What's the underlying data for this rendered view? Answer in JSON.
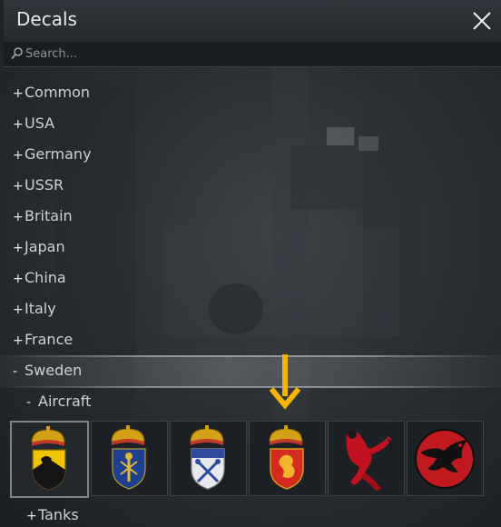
{
  "window": {
    "title": "Decals",
    "close_icon": "close-icon"
  },
  "search": {
    "placeholder": "Search...",
    "value": "",
    "icon": "search-icon"
  },
  "tree": {
    "countries": [
      {
        "sign": "+",
        "label": "Common"
      },
      {
        "sign": "+",
        "label": "USA"
      },
      {
        "sign": "+",
        "label": "Germany"
      },
      {
        "sign": "+",
        "label": "USSR"
      },
      {
        "sign": "+",
        "label": "Britain"
      },
      {
        "sign": "+",
        "label": "Japan"
      },
      {
        "sign": "+",
        "label": "China"
      },
      {
        "sign": "+",
        "label": "Italy"
      },
      {
        "sign": "+",
        "label": "France"
      },
      {
        "sign": "-",
        "label": "Sweden"
      }
    ],
    "sub_aircraft": {
      "sign": "-",
      "label": "Aircraft"
    },
    "sub_tanks": {
      "sign": "+",
      "label": "Tanks"
    }
  },
  "decals": [
    {
      "name": "crowned-shield-black-gold-lion-icon",
      "selected": true
    },
    {
      "name": "crowned-shield-blue-sheaf-icon",
      "selected": false
    },
    {
      "name": "crowned-shield-white-crossed-keys-icon",
      "selected": false
    },
    {
      "name": "crowned-shield-red-griffin-icon",
      "selected": false
    },
    {
      "name": "red-devil-pinup-icon",
      "selected": false
    },
    {
      "name": "red-circle-black-bird-icon",
      "selected": false
    }
  ],
  "pointer": {
    "icon": "down-arrow-icon",
    "color": "#f5b400"
  },
  "colors": {
    "accent_arrow": "#f5b400",
    "text": "#cdd1d4"
  }
}
